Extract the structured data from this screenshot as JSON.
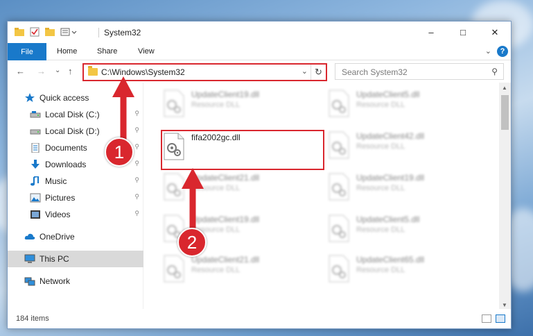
{
  "window": {
    "title": "System32",
    "minimize_glyph": "–",
    "maximize_glyph": "□",
    "close_glyph": "✕"
  },
  "ribbon": {
    "file": "File",
    "tabs": [
      "Home",
      "Share",
      "View"
    ],
    "help": "?",
    "collapse_glyph": "⌄"
  },
  "nav": {
    "back": "←",
    "forward": "→",
    "recent": "⌄",
    "up": "↑",
    "address": "C:\\Windows\\System32",
    "address_dropdown": "⌄",
    "refresh": "↻",
    "search_placeholder": "Search System32",
    "search_glyph": "⚲"
  },
  "sidebar": {
    "items": [
      {
        "label": "Quick access",
        "icon": "star-icon",
        "pinned": false
      },
      {
        "label": "Local Disk (C:)",
        "icon": "drive-icon",
        "pinned": true
      },
      {
        "label": "Local Disk (D:)",
        "icon": "drive-icon",
        "pinned": true
      },
      {
        "label": "Documents",
        "icon": "documents-icon",
        "pinned": true
      },
      {
        "label": "Downloads",
        "icon": "downloads-icon",
        "pinned": true
      },
      {
        "label": "Music",
        "icon": "music-icon",
        "pinned": true
      },
      {
        "label": "Pictures",
        "icon": "pictures-icon",
        "pinned": true
      },
      {
        "label": "Videos",
        "icon": "videos-icon",
        "pinned": true
      },
      {
        "label": "OneDrive",
        "icon": "cloud-icon",
        "pinned": false
      },
      {
        "label": "This PC",
        "icon": "computer-icon",
        "pinned": false,
        "selected": true
      },
      {
        "label": "Network",
        "icon": "network-icon",
        "pinned": false
      }
    ],
    "pin_glyph": "📌"
  },
  "files": [
    {
      "name": "UpdateClient19.dll",
      "type": "Resource DLL",
      "blurred": true
    },
    {
      "name": "UpdateClient5.dll",
      "type": "Resource DLL",
      "blurred": true
    },
    {
      "name": "fifa2002gc.dll",
      "type": "",
      "blurred": false
    },
    {
      "name": "UpdateClient42.dll",
      "type": "Resource DLL",
      "blurred": true
    },
    {
      "name": "UpdateClient21.dll",
      "type": "Resource DLL",
      "blurred": true
    },
    {
      "name": "UpdateClient19.dll",
      "type": "Resource DLL",
      "blurred": true
    },
    {
      "name": "UpdateClient19.dll",
      "type": "Resource DLL",
      "blurred": true
    },
    {
      "name": "UpdateClient5.dll",
      "type": "Resource DLL",
      "blurred": true
    },
    {
      "name": "UpdateClient21.dll",
      "type": "Resource DLL",
      "blurred": true
    },
    {
      "name": "UpdateClient65.dll",
      "type": "Resource DLL",
      "blurred": true
    }
  ],
  "status": {
    "count": "184 items"
  },
  "annotations": {
    "step1": "1",
    "step2": "2",
    "color": "#d9272e"
  }
}
